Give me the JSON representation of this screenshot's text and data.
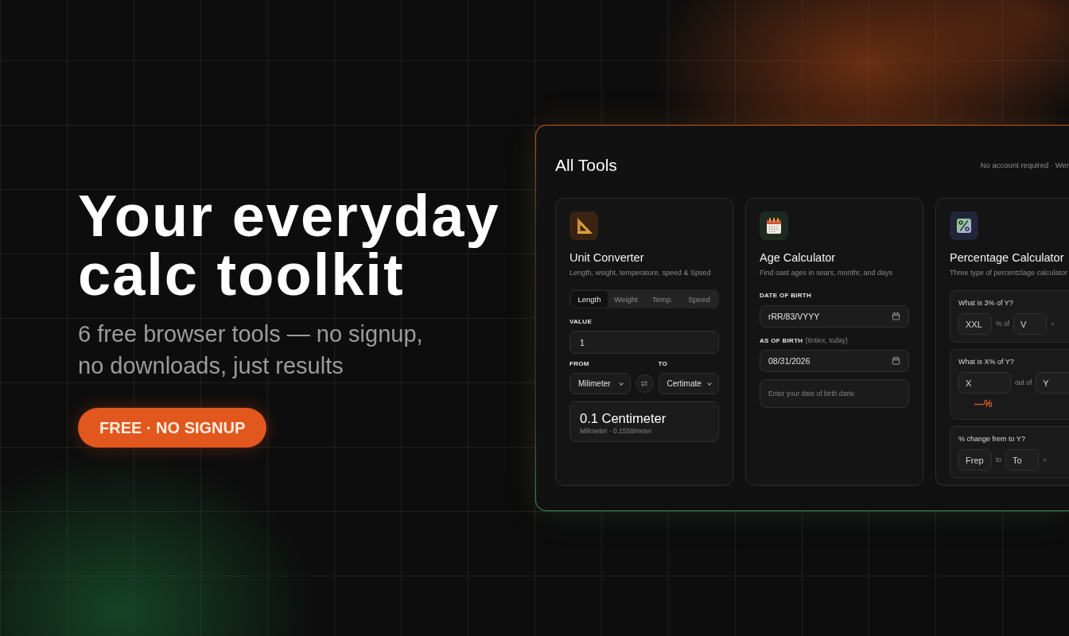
{
  "hero": {
    "heading": "Your everyday calc toolkit",
    "subheading": "6 free browser tools — no signup, no downloads, just results",
    "badge": "FREE · NO SIGNUP"
  },
  "panel": {
    "title": "All Tools",
    "note": "No account required · Wer",
    "tools": [
      {
        "kind": "converter",
        "title": "Unit Converter",
        "description": "Length, wsight, temperature, speed & Spsed",
        "tabs": [
          {
            "label": "Length",
            "selected": true
          },
          {
            "label": "Weight",
            "selected": false
          },
          {
            "label": "Temp.",
            "selected": false
          },
          {
            "label": "Speed",
            "selected": false
          }
        ],
        "value": {
          "label": "VALUE",
          "value": "1"
        },
        "from": {
          "label": "FROM",
          "value": "Milimeter"
        },
        "to": {
          "label": "TO",
          "value": "Certimate"
        },
        "result": {
          "main": "0.1 Centimeter",
          "detail": "Milimeter · 0.15Stimeter"
        }
      },
      {
        "kind": "age",
        "title": "Age Calculator",
        "description": "Find oast ages in sears, monthr, and days",
        "fields": [
          {
            "label": "DATE OF BIRTH",
            "value": "rRR/83/VYYY"
          },
          {
            "label": "AS OF BIRTH",
            "hint": "(tintiex, today)",
            "value": "08/31/2026"
          }
        ],
        "result": {
          "message": "Enter your date of birth darte"
        }
      },
      {
        "kind": "percentage",
        "title": "Percentage Calculator",
        "description": "Three type of percentzlage calculator",
        "rows": [
          {
            "question": "What is 3% of Y?",
            "parts": [
              {
                "kind": "field",
                "placeholder": "XXL"
              },
              {
                "kind": "text",
                "text": "% of"
              },
              {
                "kind": "field",
                "placeholder": "V"
              },
              {
                "kind": "text",
                "text": "="
              }
            ]
          },
          {
            "question": "What is X% of Y?",
            "parts": [
              {
                "kind": "field",
                "placeholder": "X"
              },
              {
                "kind": "text",
                "text": "out of"
              },
              {
                "kind": "field",
                "placeholder": "Y"
              }
            ],
            "result": "—%"
          },
          {
            "question": "% change frem to Y?",
            "parts": [
              {
                "kind": "field",
                "placeholder": "Frep"
              },
              {
                "kind": "text",
                "text": "to"
              },
              {
                "kind": "field",
                "placeholder": "To"
              },
              {
                "kind": "text",
                "text": "="
              }
            ]
          }
        ]
      }
    ]
  }
}
